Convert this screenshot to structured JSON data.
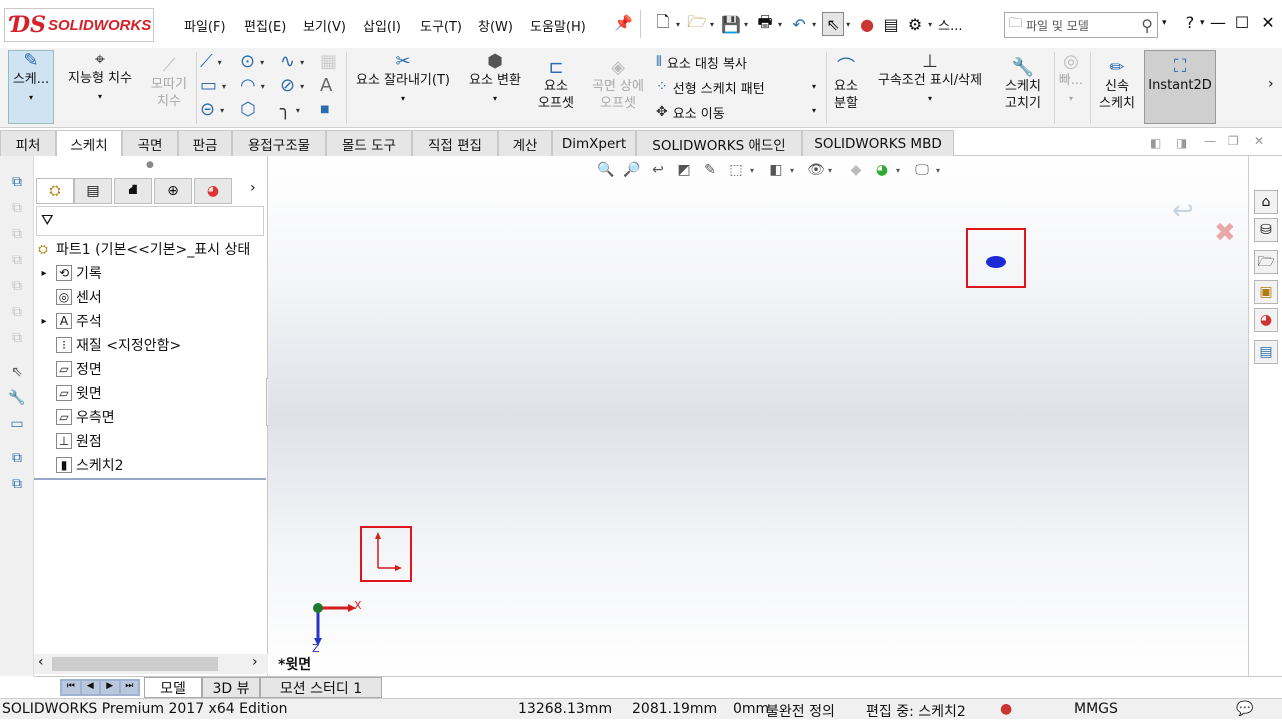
{
  "app": {
    "brand": "SOLIDWORKS"
  },
  "menu": [
    "파일(F)",
    "편집(E)",
    "보기(V)",
    "삽입(I)",
    "도구(T)",
    "창(W)",
    "도움말(H)"
  ],
  "quick_access": {
    "overflow_label": "스..."
  },
  "search": {
    "placeholder": "파일 및 모델"
  },
  "ribbon": {
    "sketch": "스케...",
    "smart_dimension": "지능형 치수",
    "chamfer_dim": [
      "모따기",
      "치수"
    ],
    "trim": "요소 잘라내기(T)",
    "convert": "요소 변환",
    "offset": [
      "요소",
      "오프셋"
    ],
    "offset_surface": [
      "곡면 상에",
      "오프셋"
    ],
    "mirror": "요소 대칭 복사",
    "linear_pattern": "선형 스케치 패턴",
    "move": "요소 이동",
    "split": [
      "요소",
      "분할"
    ],
    "relations": "구속조건 표시/삭제",
    "repair": [
      "스케치",
      "고치기"
    ],
    "quick_snaps": "빠...",
    "rapid_sketch": [
      "신속",
      "스케치"
    ],
    "instant2d": "Instant2D"
  },
  "command_tabs": [
    "피처",
    "스케치",
    "곡면",
    "판금",
    "용접구조물",
    "몰드 도구",
    "직접 편집",
    "계산",
    "DimXpert",
    "SOLIDWORKS 애드인",
    "SOLIDWORKS MBD"
  ],
  "active_tab": "스케치",
  "feature_tree": {
    "root": "파트1  (기본<<기본>_표시 상태",
    "items": [
      {
        "label": "기록",
        "expand": "▸"
      },
      {
        "label": "센서",
        "expand": ""
      },
      {
        "label": "주석",
        "expand": "▸"
      },
      {
        "label": "재질 <지정안함>",
        "expand": ""
      },
      {
        "label": "정면",
        "expand": ""
      },
      {
        "label": "윗면",
        "expand": ""
      },
      {
        "label": "우측면",
        "expand": ""
      },
      {
        "label": "원점",
        "expand": ""
      },
      {
        "label": "스케치2",
        "expand": ""
      }
    ]
  },
  "viewport": {
    "view_label": "*윗면",
    "axis_x": "X",
    "axis_z": "Z"
  },
  "bottom_tabs": [
    "모델",
    "3D 뷰",
    "모션 스터디 1"
  ],
  "status": {
    "edition": "SOLIDWORKS Premium 2017 x64 Edition",
    "x": "13268.13mm",
    "y": "2081.19mm",
    "z": "0mm",
    "definition": "불완전 정의",
    "editing": "편집 중: 스케치2",
    "units": "MMGS"
  },
  "colors": {
    "accent_blue": "#2b6cb0",
    "highlight_red": "#e0141e",
    "brand_red": "#d6202a"
  }
}
